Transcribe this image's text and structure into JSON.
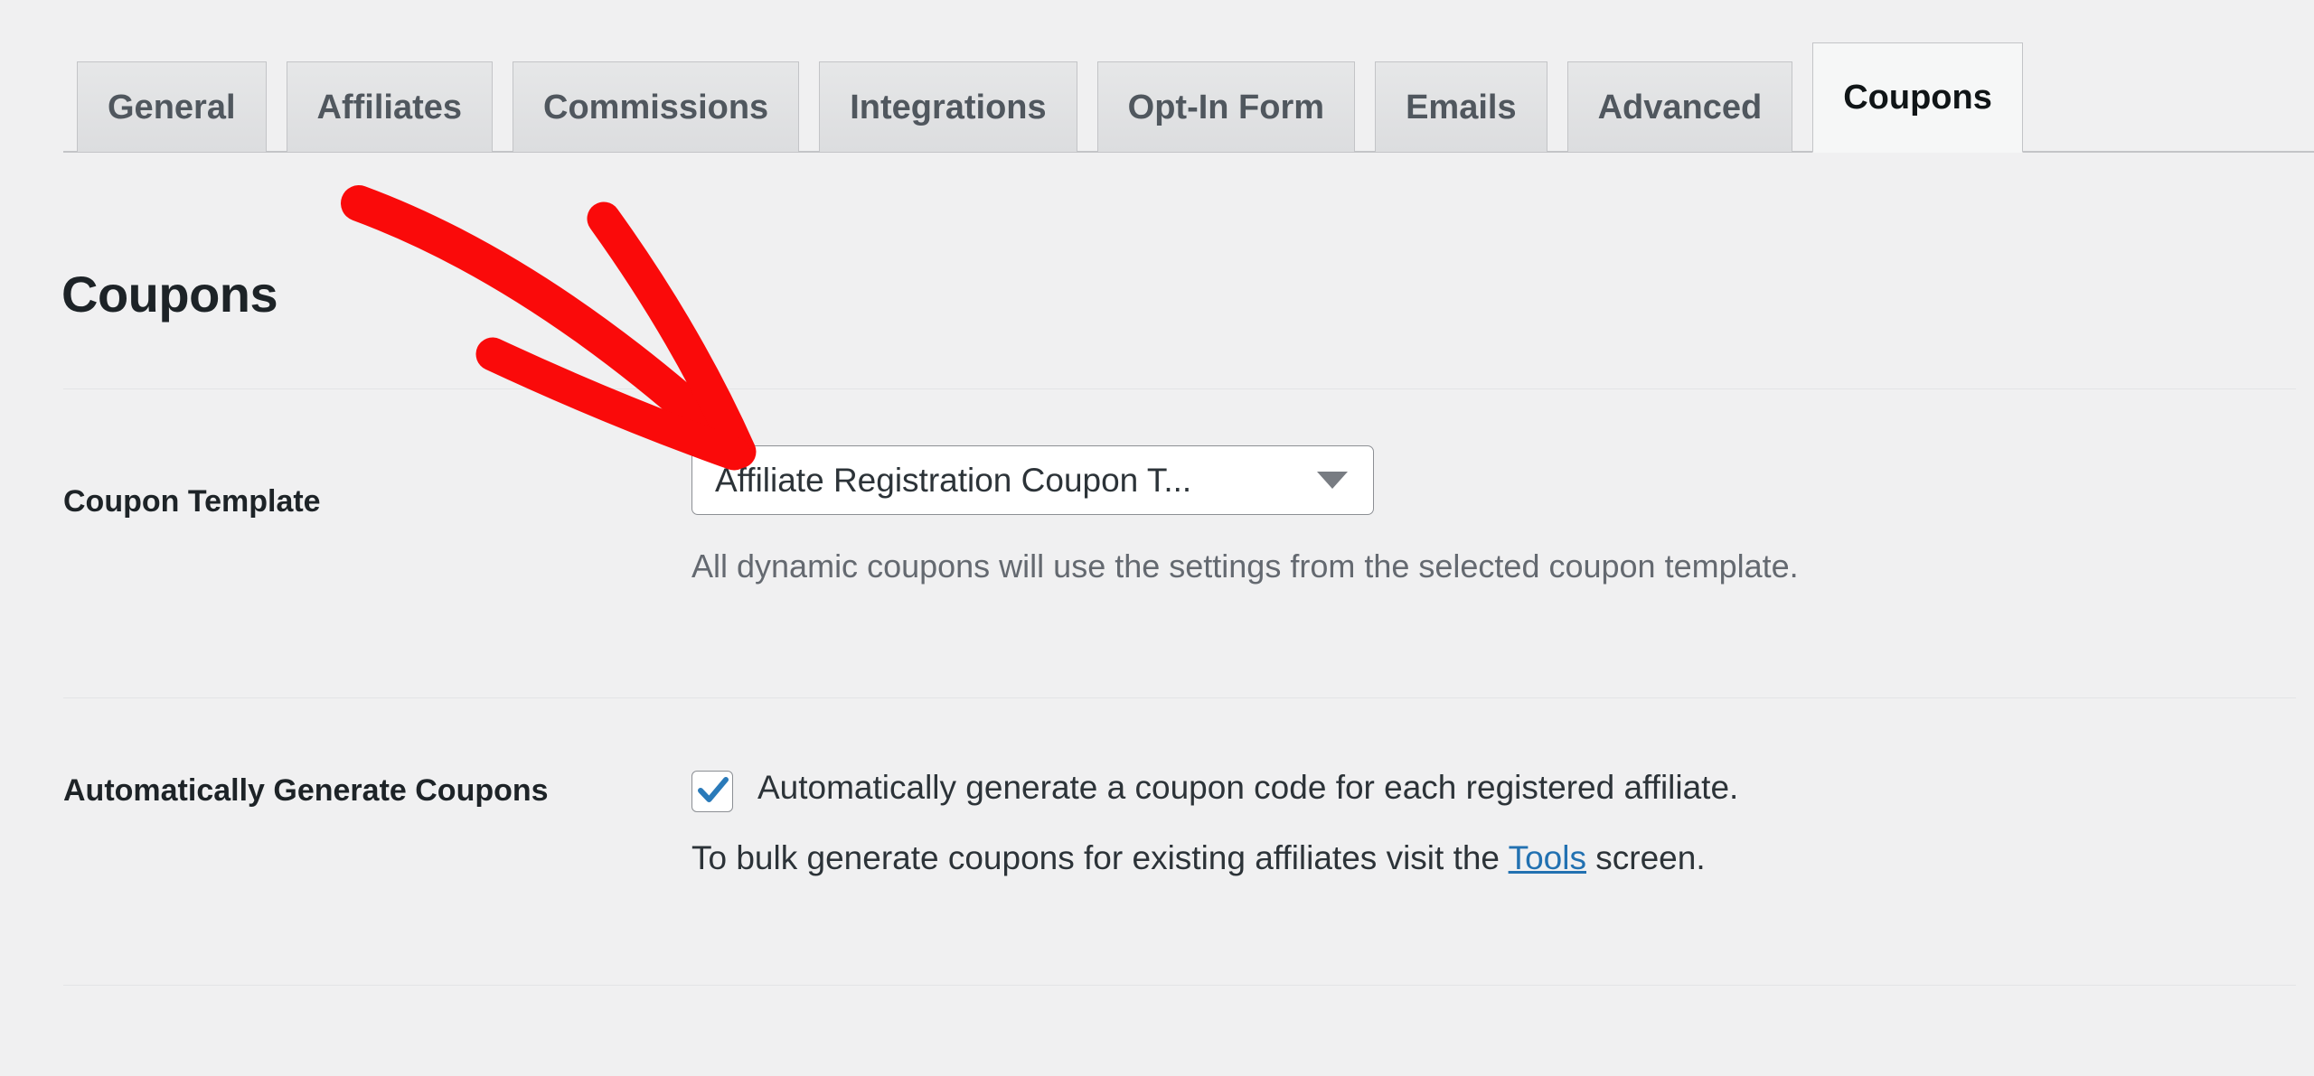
{
  "tabs": [
    {
      "label": "General",
      "active": false
    },
    {
      "label": "Affiliates",
      "active": false
    },
    {
      "label": "Commissions",
      "active": false
    },
    {
      "label": "Integrations",
      "active": false
    },
    {
      "label": "Opt-In Form",
      "active": false
    },
    {
      "label": "Emails",
      "active": false
    },
    {
      "label": "Advanced",
      "active": false
    },
    {
      "label": "Coupons",
      "active": true
    }
  ],
  "page": {
    "title": "Coupons"
  },
  "settings": {
    "coupon_template": {
      "label": "Coupon Template",
      "selected_option": "Affiliate Registration Coupon T...",
      "dropdown_icon": "chevron-down-icon",
      "help_text": "All dynamic coupons will use the settings from the selected coupon template."
    },
    "auto_generate": {
      "label": "Automatically Generate Coupons",
      "checkbox_checked": true,
      "checkbox_icon": "checkmark-icon",
      "checkbox_label": "Automatically generate a coupon code for each registered affiliate.",
      "bulk_text_before": "To bulk generate coupons for existing affiliates visit the ",
      "bulk_link_label": "Tools",
      "bulk_text_after": " screen."
    }
  },
  "annotation": {
    "type": "red-arrow",
    "color": "#fa0a0a",
    "points_to": "coupon-template-select"
  },
  "colors": {
    "background": "#f0f0f1",
    "text_dark": "#1d2327",
    "text_muted": "#646970",
    "link": "#2271b1",
    "accent_check": "#2a7ab9",
    "border": "#c3c4c7",
    "annotation_red": "#fa0a0a"
  }
}
